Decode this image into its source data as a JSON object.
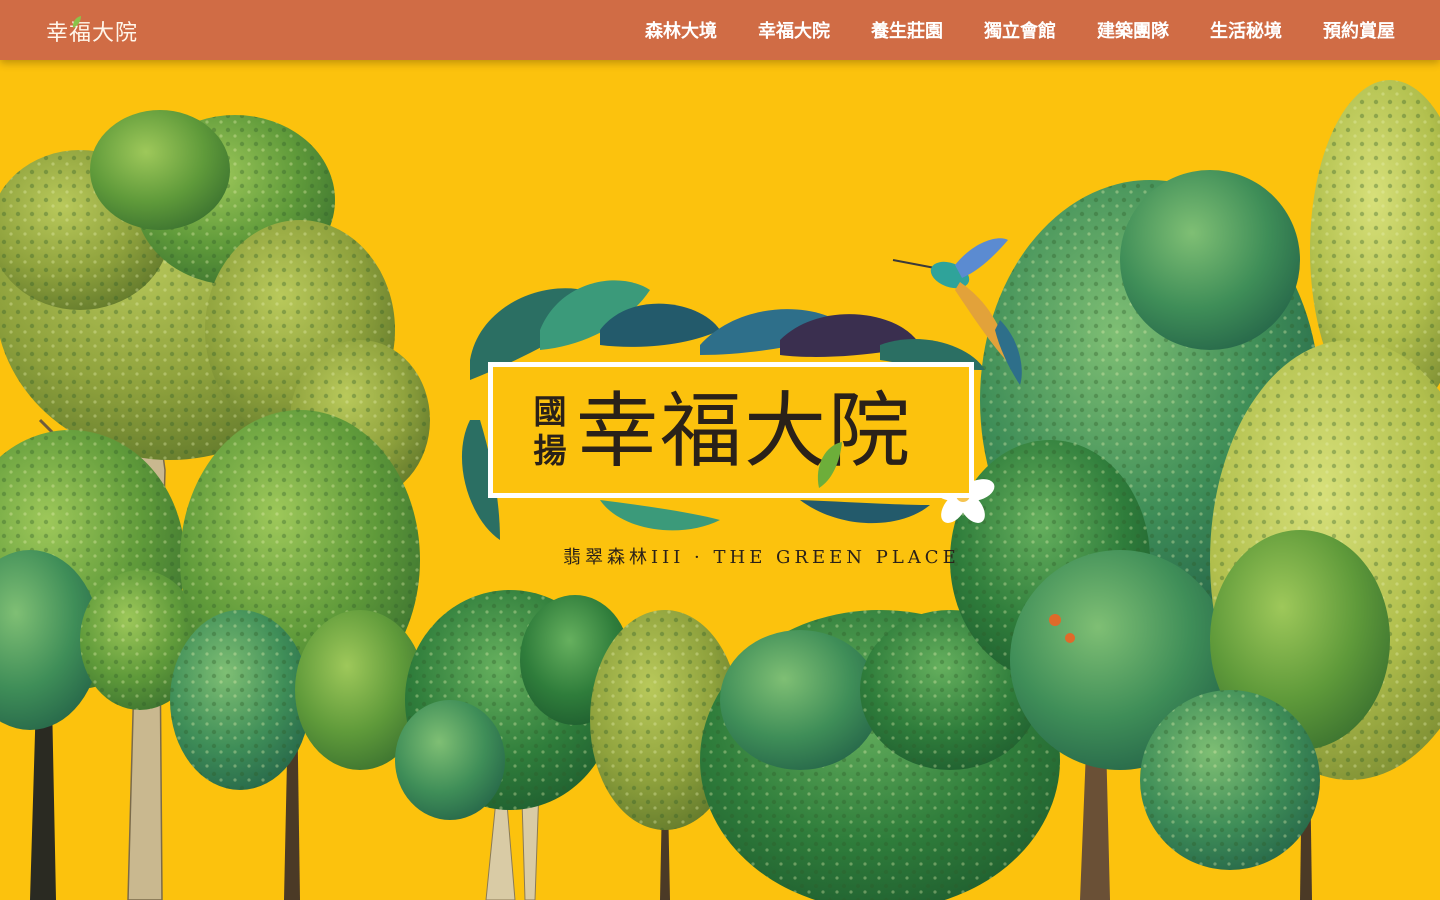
{
  "header": {
    "brand": "幸福大院",
    "nav": [
      "森林大境",
      "幸福大院",
      "養生莊園",
      "獨立會館",
      "建築團隊",
      "生活秘境",
      "預約賞屋"
    ]
  },
  "hero": {
    "logo_small": "國揚",
    "logo_big": "幸福大院",
    "tagline": "翡翠森林III · THE GREEN PLACE"
  },
  "colors": {
    "header_bg": "#d06c45",
    "background": "#fcc20d",
    "text_dark": "#2a2119"
  },
  "icons": [
    "hummingbird-icon",
    "plumeria-flower-icon",
    "monstera-leaf-icon",
    "leaf-icon"
  ]
}
